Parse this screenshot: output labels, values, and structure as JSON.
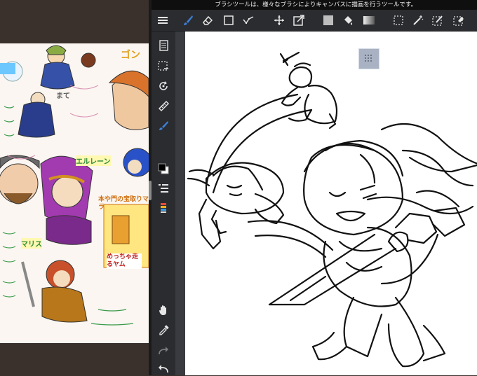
{
  "status_bar": {
    "hint_text": "ブラシツールは、様々なブラシによりキャンバスに描画を行うツールです。"
  },
  "toolbar": {
    "tools": [
      {
        "name": "menu-button",
        "icon": "hamburger-icon"
      },
      {
        "name": "brush-tool-button",
        "icon": "brush-icon",
        "active": true
      },
      {
        "name": "eraser-tool-button",
        "icon": "eraser-icon"
      },
      {
        "name": "shape-tool-button",
        "icon": "square-icon"
      },
      {
        "name": "select-tool-button",
        "icon": "polyline-icon"
      },
      {
        "name": "move-tool-button",
        "icon": "move-icon"
      },
      {
        "name": "transform-tool-button",
        "icon": "transform-icon"
      },
      {
        "name": "fill-color-button",
        "icon": "color-square-icon"
      },
      {
        "name": "bucket-tool-button",
        "icon": "bucket-icon"
      },
      {
        "name": "gradient-tool-button",
        "icon": "gradient-icon"
      },
      {
        "name": "select-rect-button",
        "icon": "dashed-rect-icon"
      },
      {
        "name": "magic-wand-button",
        "icon": "magic-wand-icon"
      },
      {
        "name": "select-pen-button",
        "icon": "select-pen-icon"
      },
      {
        "name": "select-eraser-button",
        "icon": "select-eraser-icon"
      }
    ]
  },
  "sidebar": {
    "tools": [
      {
        "name": "pages-button",
        "icon": "pages-icon"
      },
      {
        "name": "deselect-button",
        "icon": "deselect-icon"
      },
      {
        "name": "rotate-button",
        "icon": "rotate-icon"
      },
      {
        "name": "ruler-button",
        "icon": "ruler-icon"
      },
      {
        "name": "brush-sidebar-button",
        "icon": "pen-icon"
      },
      {
        "name": "color-swatch-button",
        "icon": "color-swatch-icon"
      },
      {
        "name": "layers-button",
        "icon": "layers-icon"
      },
      {
        "name": "palette-button",
        "icon": "palette-icon"
      },
      {
        "name": "hand-tool-button",
        "icon": "hand-icon"
      },
      {
        "name": "eyedropper-button",
        "icon": "eyedropper-icon"
      },
      {
        "name": "redo-button",
        "icon": "redo-icon"
      },
      {
        "name": "undo-button",
        "icon": "undo-icon"
      }
    ]
  },
  "colors": {
    "app_bg": "#2d2f33",
    "toolbar_bg": "#2a2c30",
    "active_tool": "#3d7fd6",
    "canvas": "#ffffff",
    "left_bg": "#3a302c"
  },
  "reference_image": {
    "marks": [
      {
        "text": "ゴン",
        "color": "#e0a020"
      },
      {
        "text": "エルレーン",
        "color": "#2a8a3a"
      },
      {
        "text": "マリス",
        "color": "#2a8a3a"
      },
      {
        "text": "まて",
        "color": "#5a5a5a"
      },
      {
        "text": "本や門の宝取りマラ",
        "color": "#d07010"
      },
      {
        "text": "めっちゃ走るヤム",
        "color": "#c02020"
      }
    ]
  }
}
